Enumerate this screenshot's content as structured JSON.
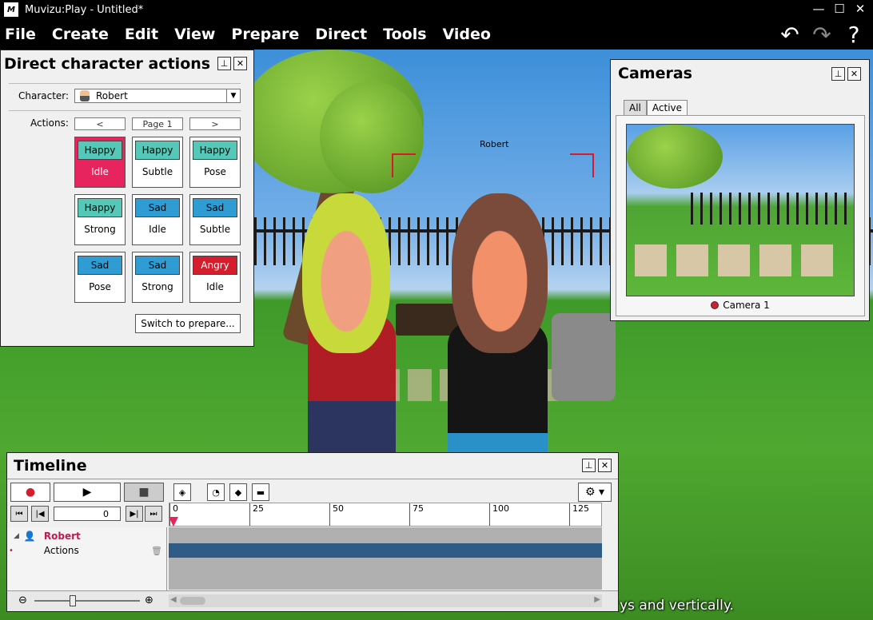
{
  "window": {
    "title": "Muvizu:Play - Untitled*",
    "app_icon": "M",
    "minimize": "—",
    "maximize": "☐",
    "close": "✕"
  },
  "menu": {
    "items": [
      "File",
      "Create",
      "Edit",
      "View",
      "Prepare",
      "Direct",
      "Tools",
      "Video"
    ],
    "undo_icon": "undo-icon",
    "redo_icon": "redo-icon",
    "help": "?"
  },
  "scene": {
    "character_label": "Robert",
    "subtitle_text": "ys and vertically."
  },
  "direct_actions": {
    "title": "Direct character actions",
    "character_label": "Character:",
    "character_value": "Robert",
    "actions_label": "Actions:",
    "prev_page": "<",
    "page_label": "Page 1",
    "next_page": ">",
    "actions": [
      {
        "mood": "Happy",
        "action": "Idle",
        "kind": "happy",
        "selected": true
      },
      {
        "mood": "Happy",
        "action": "Subtle",
        "kind": "happy",
        "selected": false
      },
      {
        "mood": "Happy",
        "action": "Pose",
        "kind": "happy",
        "selected": false
      },
      {
        "mood": "Happy",
        "action": "Strong",
        "kind": "happy",
        "selected": false
      },
      {
        "mood": "Sad",
        "action": "Idle",
        "kind": "sad",
        "selected": false
      },
      {
        "mood": "Sad",
        "action": "Subtle",
        "kind": "sad",
        "selected": false
      },
      {
        "mood": "Sad",
        "action": "Pose",
        "kind": "sad",
        "selected": false
      },
      {
        "mood": "Sad",
        "action": "Strong",
        "kind": "sad",
        "selected": false
      },
      {
        "mood": "Angry",
        "action": "Idle",
        "kind": "angry",
        "selected": false
      }
    ],
    "switch_button": "Switch to prepare..."
  },
  "cameras": {
    "title": "Cameras",
    "tabs": [
      "All",
      "Active"
    ],
    "active_tab": "Active",
    "camera_name": "Camera 1"
  },
  "timeline": {
    "title": "Timeline",
    "frame_value": "0",
    "ruler_ticks": [
      "0",
      "25",
      "50",
      "75",
      "100",
      "125"
    ],
    "track_character": "Robert",
    "track_actions": "Actions"
  },
  "colors": {
    "accent": "#e8245e",
    "happy": "#55c8b8",
    "sad": "#2f9cd4",
    "angry": "#d41e2e",
    "track": "#2e5c86"
  }
}
